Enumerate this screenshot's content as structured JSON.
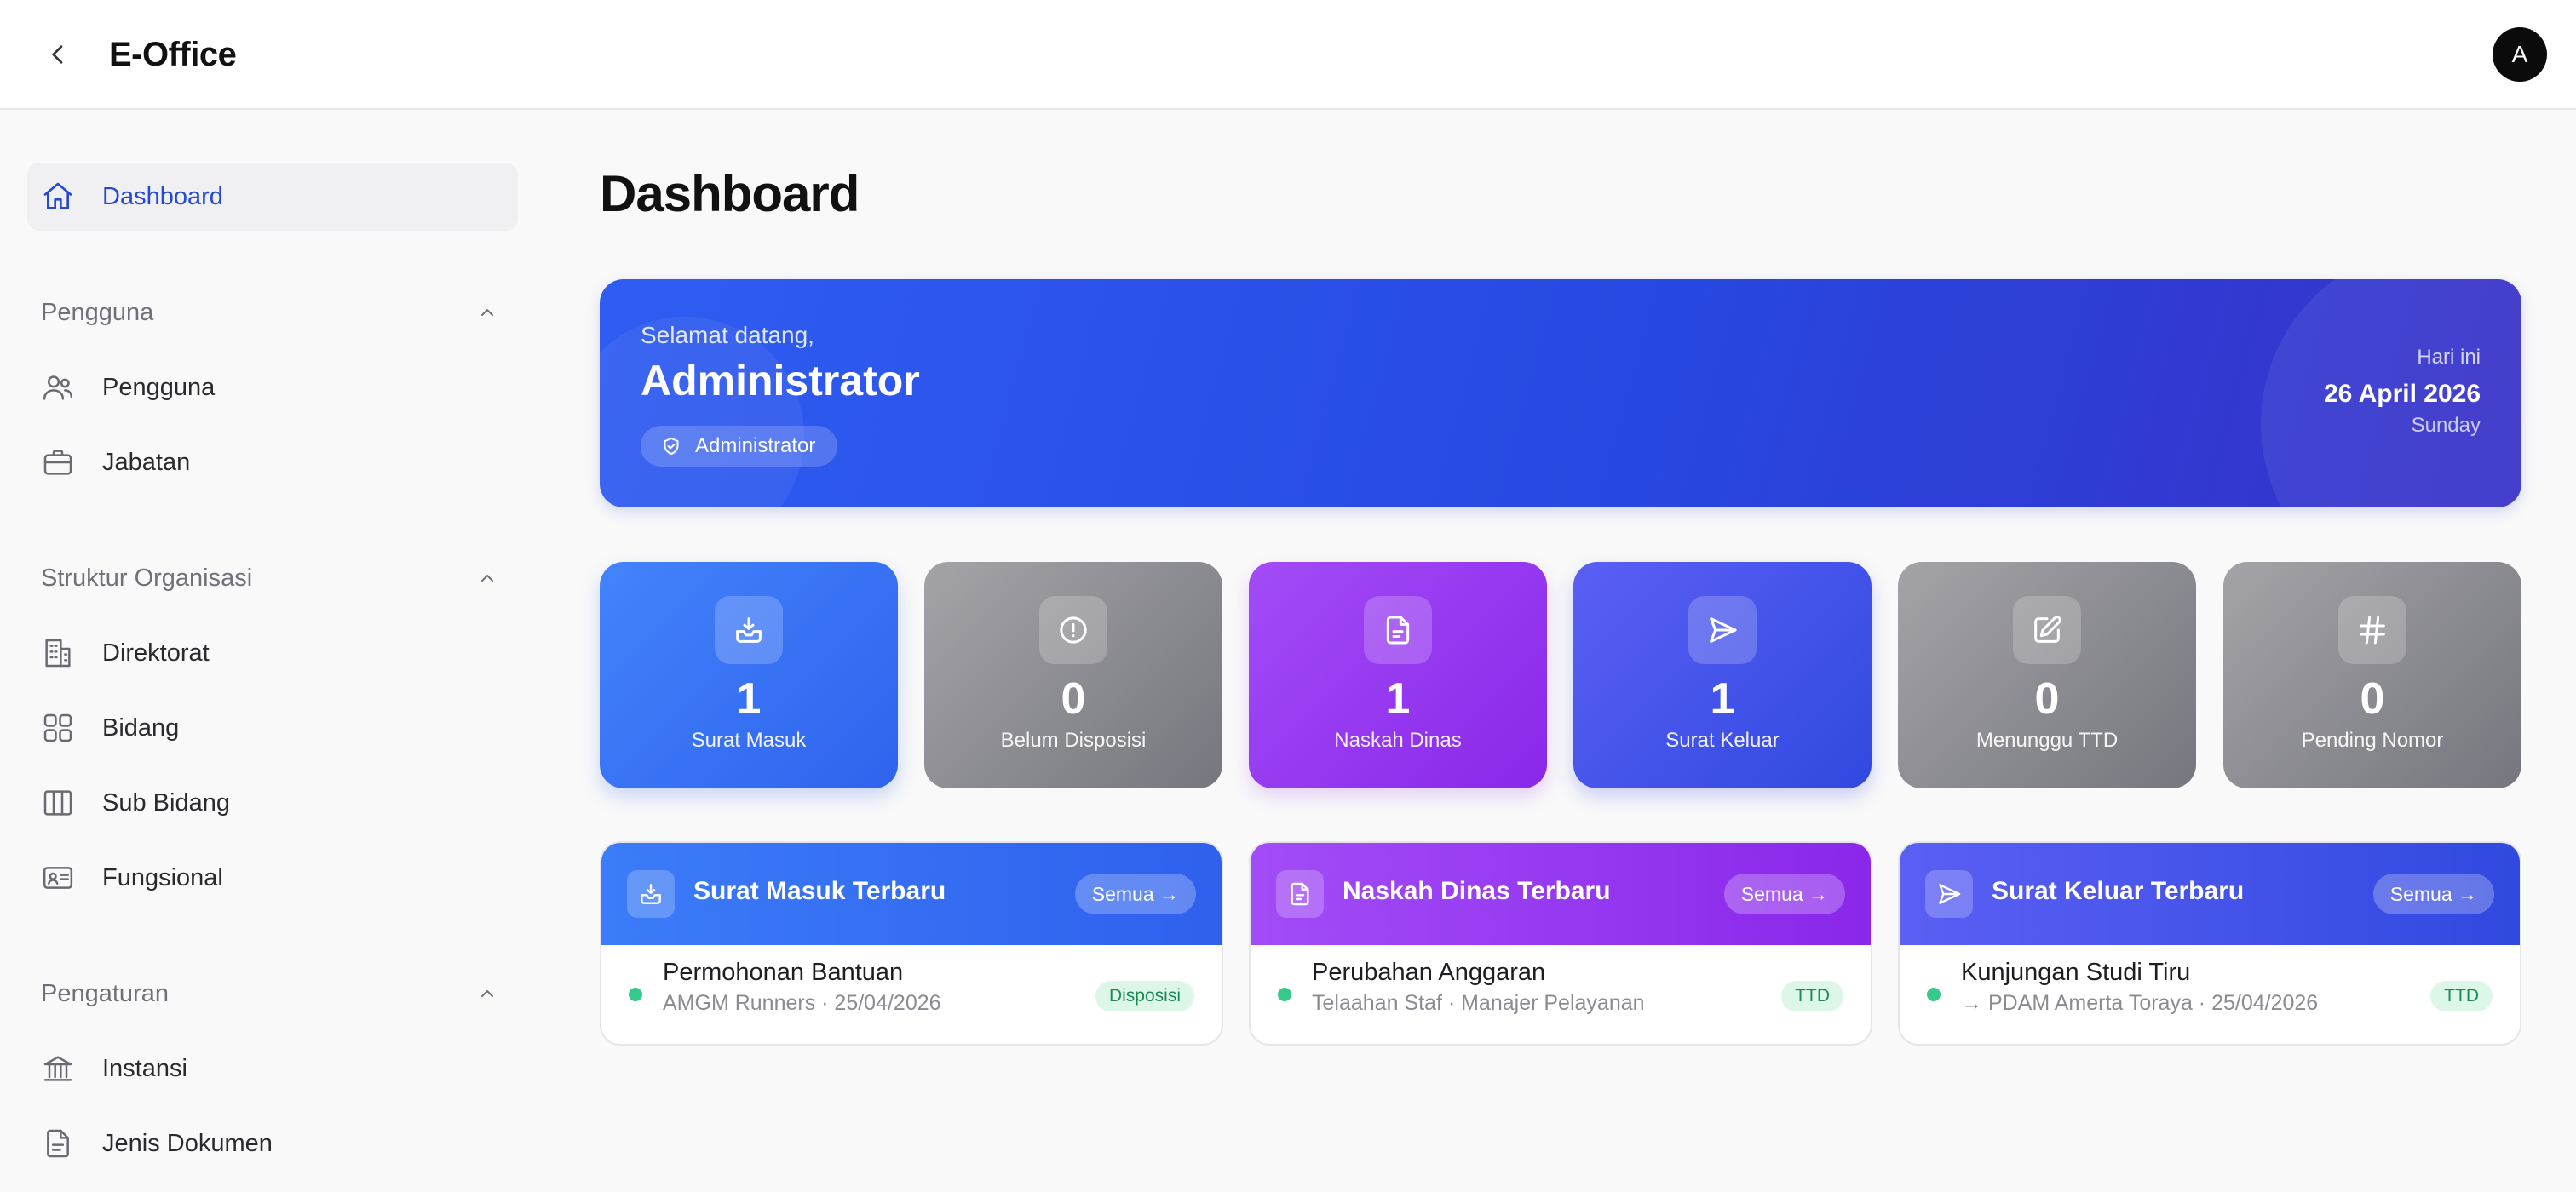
{
  "app": {
    "title": "E-Office",
    "avatar_initial": "A"
  },
  "sidebar": {
    "dashboard": "Dashboard",
    "sections": [
      {
        "title": "Pengguna",
        "items": [
          "Pengguna",
          "Jabatan"
        ]
      },
      {
        "title": "Struktur Organisasi",
        "items": [
          "Direktorat",
          "Bidang",
          "Sub Bidang",
          "Fungsional"
        ]
      },
      {
        "title": "Pengaturan",
        "items": [
          "Instansi",
          "Jenis Dokumen"
        ]
      }
    ]
  },
  "main": {
    "page_title": "Dashboard",
    "welcome": {
      "greeting": "Selamat datang,",
      "user_name": "Administrator",
      "role": "Administrator",
      "today_label": "Hari ini",
      "date": "26 April 2026",
      "day": "Sunday"
    },
    "stats": [
      {
        "value": "1",
        "label": "Surat Masuk",
        "icon": "inbox-icon"
      },
      {
        "value": "0",
        "label": "Belum Disposisi",
        "icon": "alert-circle-icon"
      },
      {
        "value": "1",
        "label": "Naskah Dinas",
        "icon": "document-icon"
      },
      {
        "value": "1",
        "label": "Surat Keluar",
        "icon": "send-icon"
      },
      {
        "value": "0",
        "label": "Menunggu TTD",
        "icon": "edit-icon"
      },
      {
        "value": "0",
        "label": "Pending Nomor",
        "icon": "hash-icon"
      }
    ],
    "recent": [
      {
        "title": "Surat Masuk Terbaru",
        "all_label": "Semua →",
        "item": {
          "title": "Permohonan Bantuan",
          "subtitle": "AMGM Runners · 25/04/2026",
          "badge": "Disposisi"
        }
      },
      {
        "title": "Naskah Dinas Terbaru",
        "all_label": "Semua →",
        "item": {
          "title": "Perubahan Anggaran",
          "subtitle": "Telaahan Staf · Manajer Pelayanan",
          "badge": "TTD"
        }
      },
      {
        "title": "Surat Keluar Terbaru",
        "all_label": "Semua →",
        "item": {
          "title": "Kunjungan Studi Tiru",
          "subtitle": "→ PDAM Amerta Toraya · 25/04/2026",
          "badge": "TTD"
        }
      }
    ]
  },
  "colors": {
    "accent": "#2448d8",
    "blue": "#3b7cf8",
    "purple": "#8a27ea",
    "indigo": "#3049e0",
    "gray": "#76767e",
    "success": "#35c98a"
  }
}
